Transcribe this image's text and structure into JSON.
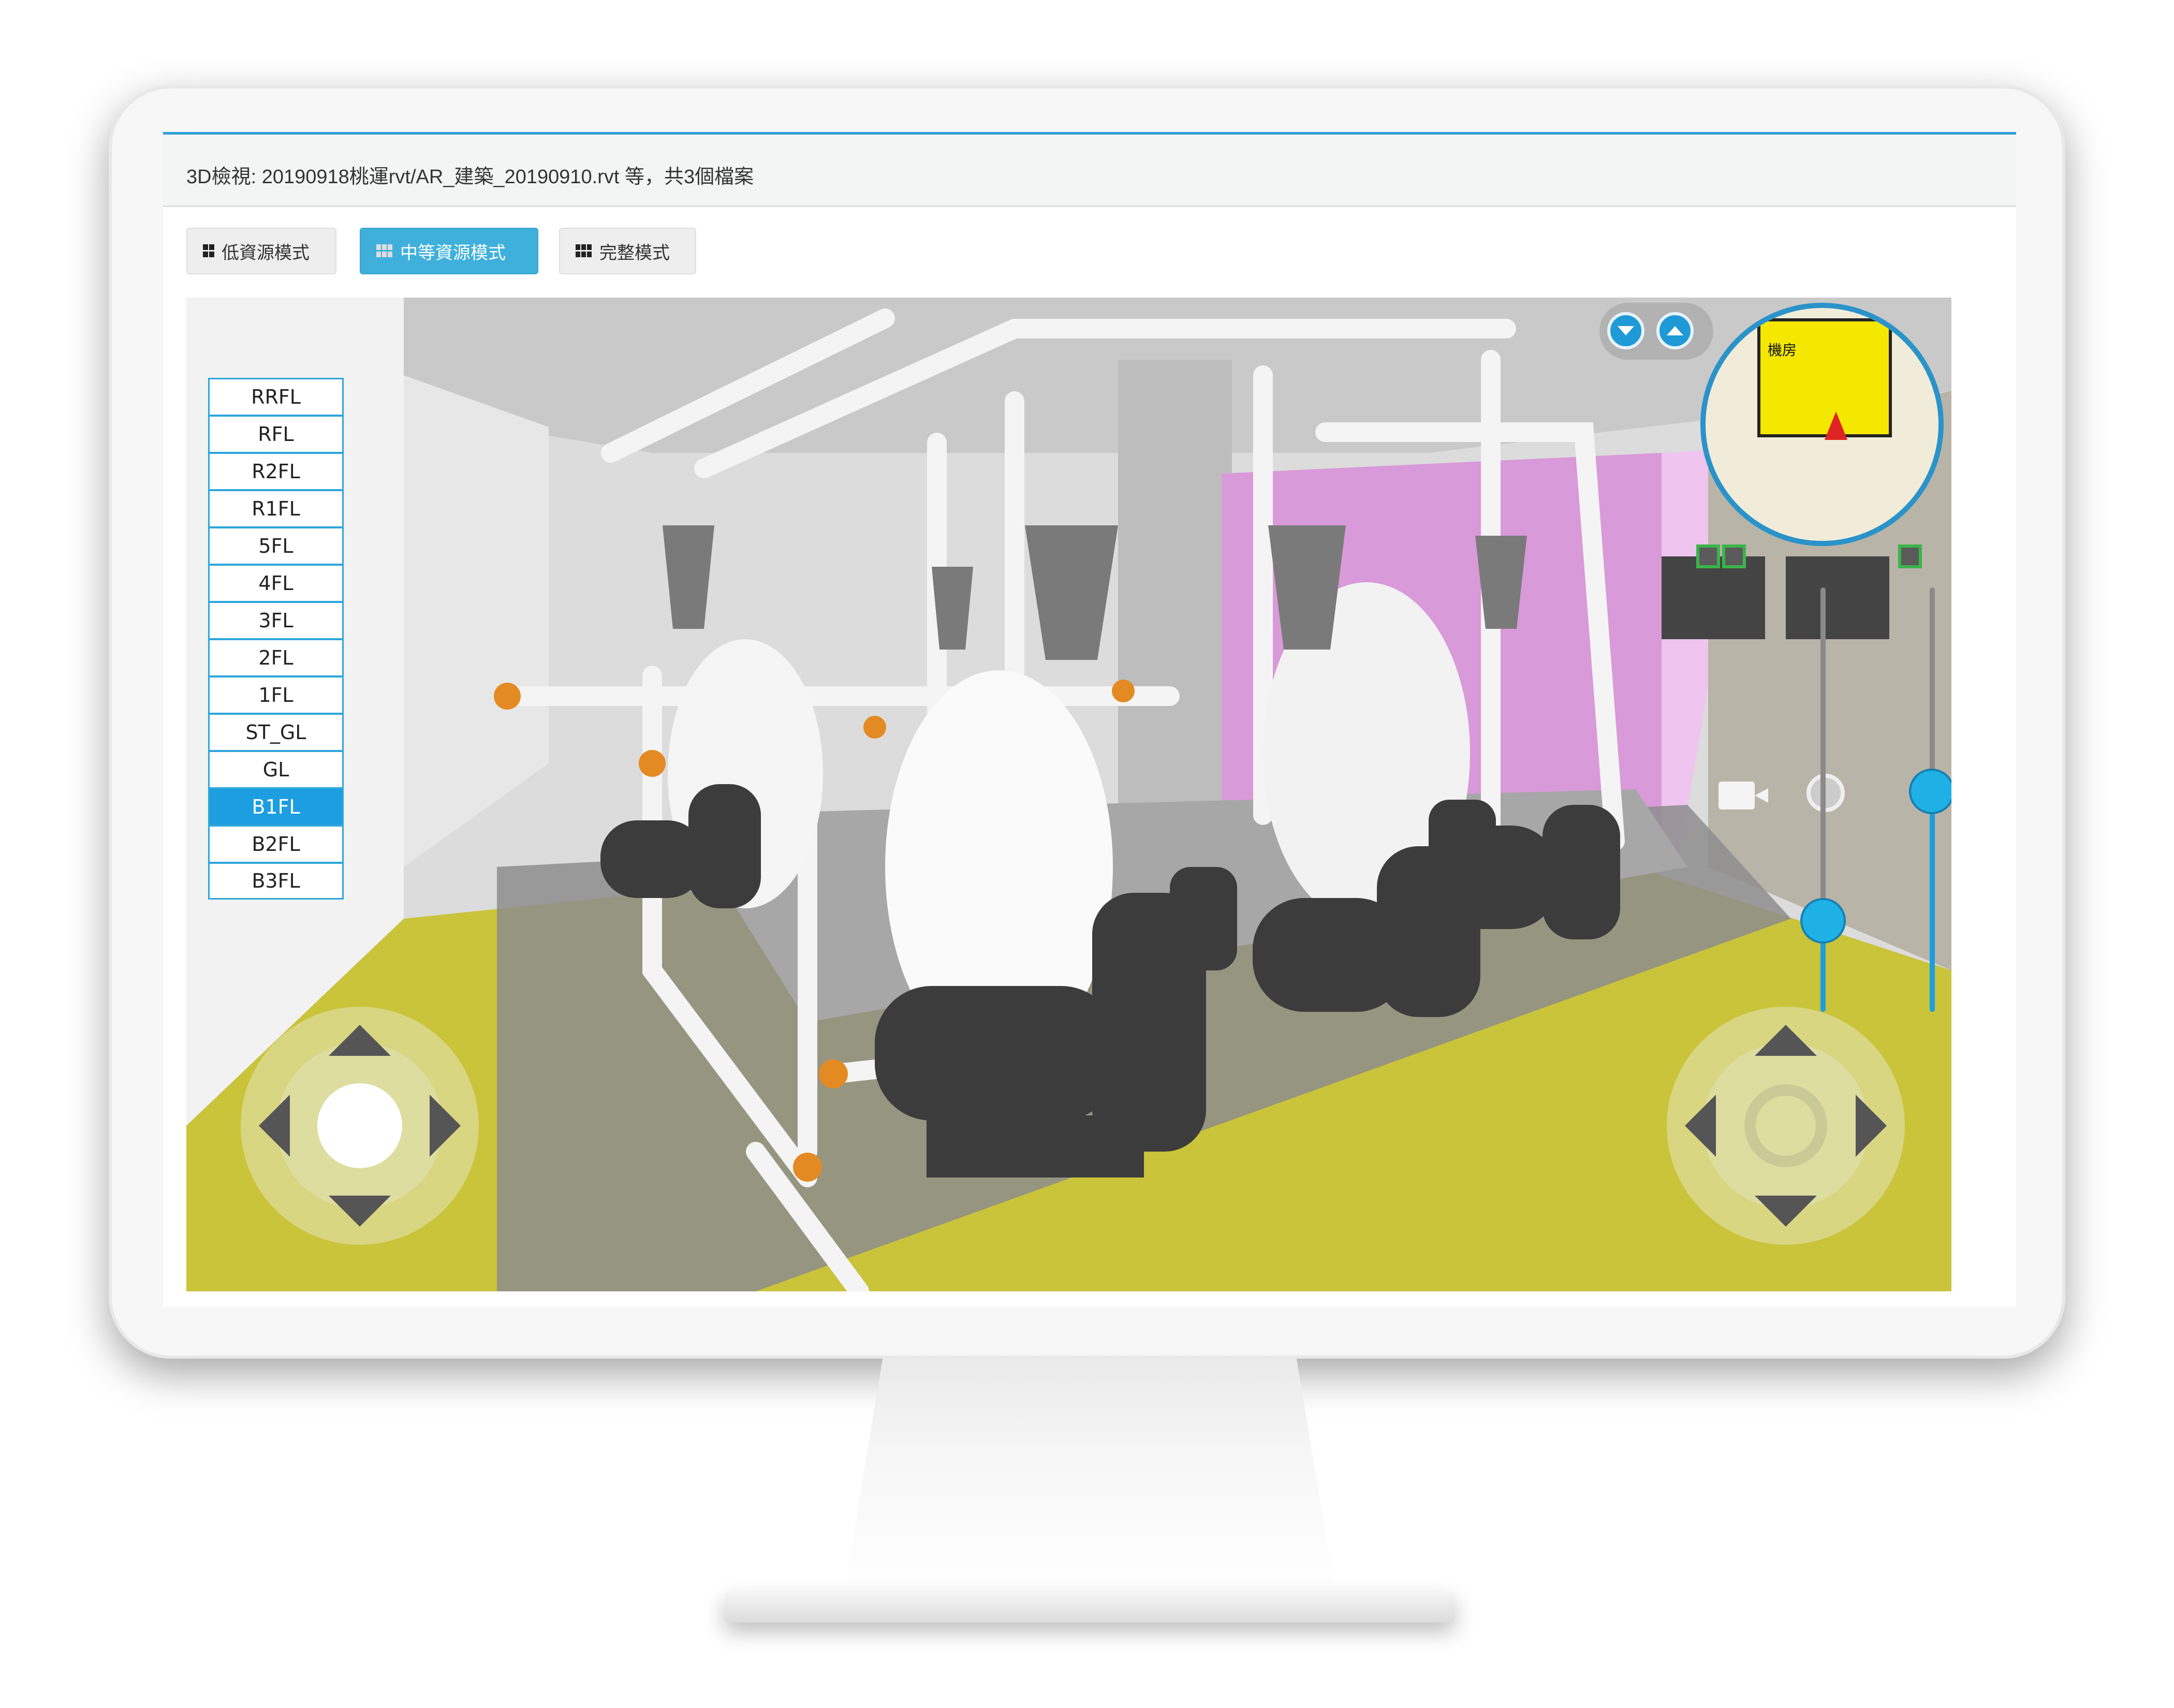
{
  "window": {
    "title": "3D檢視: 20190918桃運rvt/AR_建築_20190910.rvt 等，共3個檔案"
  },
  "modes": [
    {
      "label": "低資源模式",
      "icon": "grid-4-icon",
      "active": false
    },
    {
      "label": "中等資源模式",
      "icon": "grid-6-icon",
      "active": true
    },
    {
      "label": "完整模式",
      "icon": "grid-6-icon",
      "active": false
    }
  ],
  "floors": {
    "items": [
      "RRFL",
      "RFL",
      "R2FL",
      "R1FL",
      "5FL",
      "4FL",
      "3FL",
      "2FL",
      "1FL",
      "ST_GL",
      "GL",
      "B1FL",
      "B2FL",
      "B3FL"
    ],
    "selected": "B1FL"
  },
  "controls": {
    "move_joystick": "move-joystick",
    "look_joystick": "look-joystick",
    "camera_icon": "video-camera-icon",
    "zoom_icon": "zoom-magnifier-icon",
    "minimap_label": "機房"
  },
  "colors": {
    "accent": "#1c9ee0",
    "floor_yellow": "#c9c43a",
    "wall_magenta": "#d99ad9",
    "pump_dark": "#3c3c3c"
  }
}
